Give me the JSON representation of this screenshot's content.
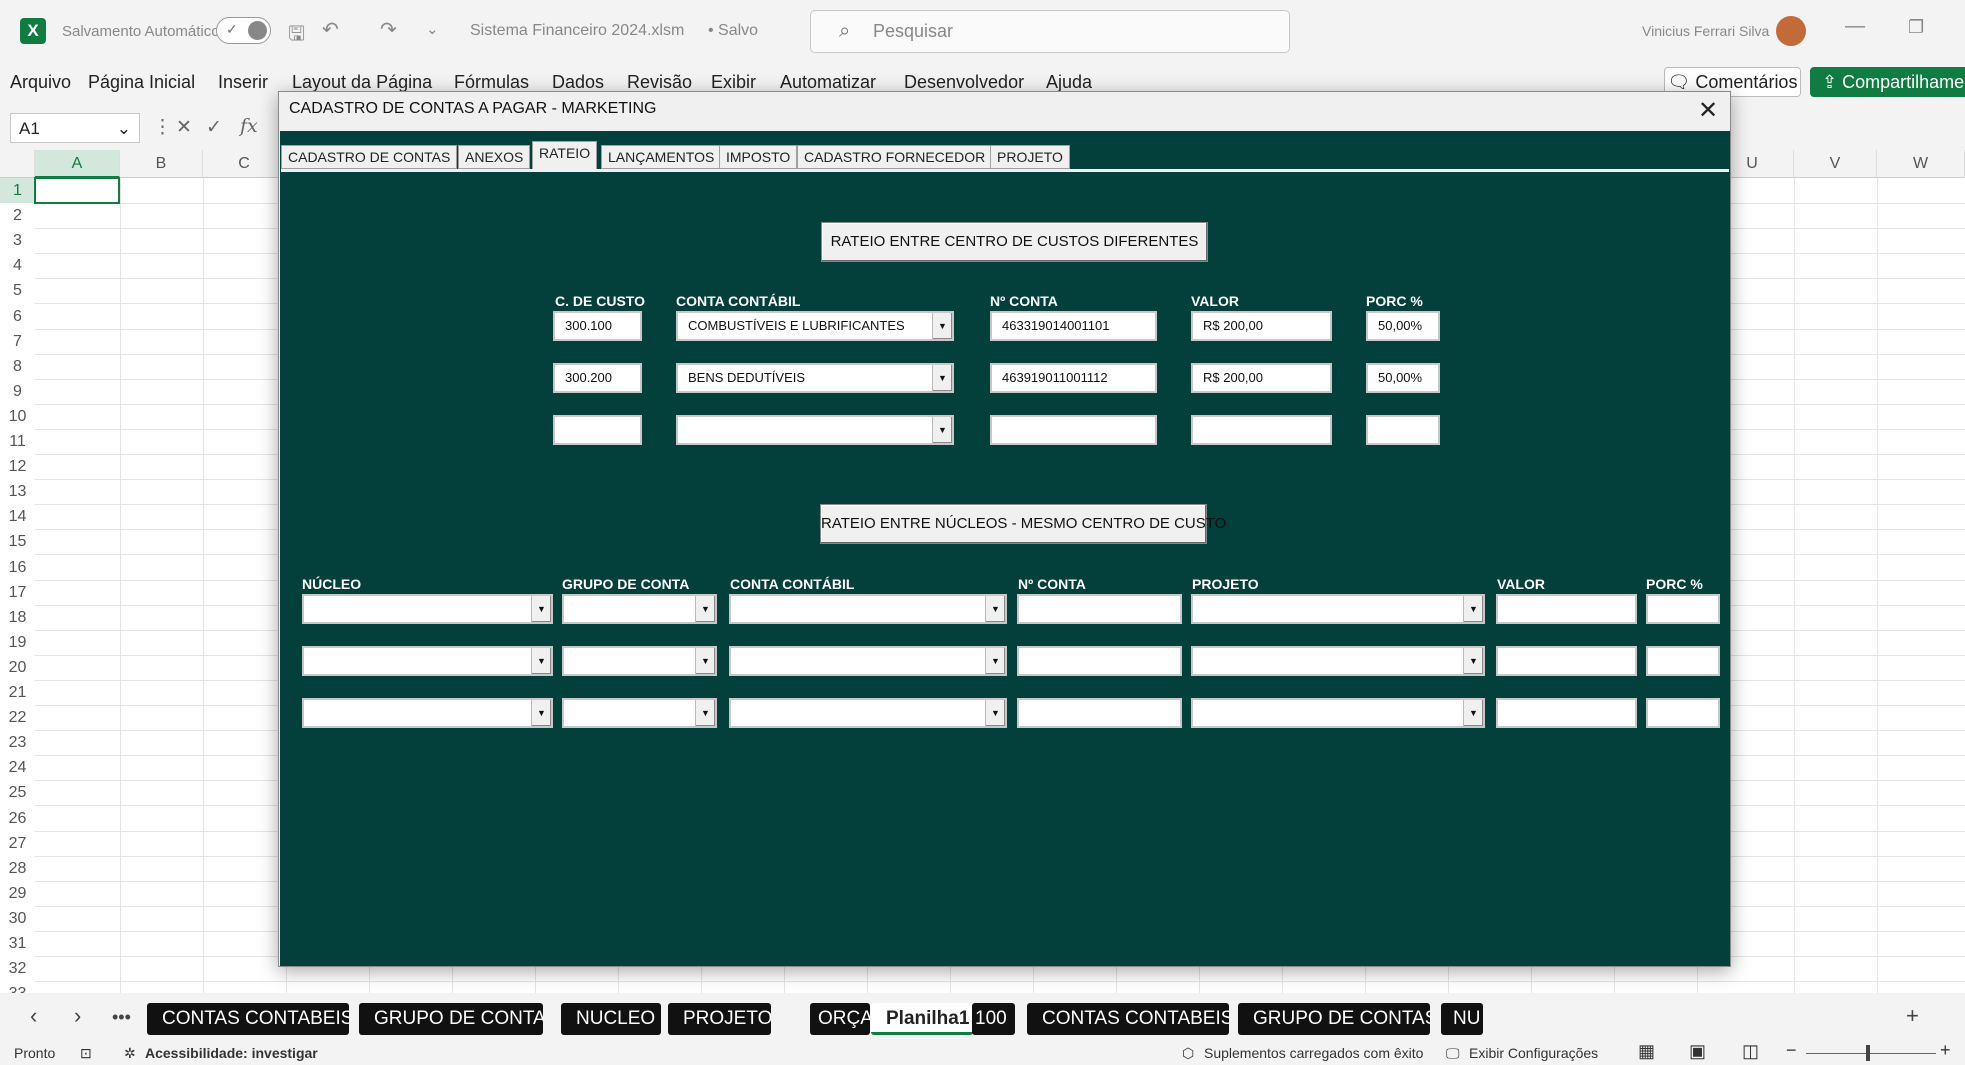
{
  "titlebar": {
    "app_icon": "X",
    "autosave_label": "Salvamento Automático",
    "file_name": "Sistema Financeiro 2024.xlsm",
    "save_status": "• Salvo",
    "search_placeholder": "Pesquisar",
    "user_name": "Vinicius Ferrari Silva"
  },
  "menu": [
    "Arquivo",
    "Página Inicial",
    "Inserir",
    "Layout da Página",
    "Fórmulas",
    "Dados",
    "Revisão",
    "Exibir",
    "Automatizar",
    "Desenvolvedor",
    "Ajuda"
  ],
  "comments_label": "Comentários",
  "share_label": "Compartilhamento",
  "formula_bar": {
    "name_box": "A1",
    "fx": "fx"
  },
  "columns": [
    "A",
    "B",
    "C",
    "U",
    "V",
    "W"
  ],
  "rows": [
    "1",
    "2",
    "3",
    "4",
    "5",
    "6",
    "7",
    "8",
    "9",
    "10",
    "11",
    "12",
    "13",
    "14",
    "15",
    "16",
    "17",
    "18",
    "19",
    "20",
    "21",
    "22",
    "23",
    "24",
    "25",
    "26",
    "27",
    "28",
    "29",
    "30",
    "31",
    "32",
    "33"
  ],
  "dialog": {
    "title": "CADASTRO DE CONTAS A PAGAR - MARKETING",
    "close": "✕",
    "tabs": [
      "CADASTRO DE CONTAS",
      "ANEXOS",
      "RATEIO",
      "LANÇAMENTOS",
      "IMPOSTO",
      "CADASTRO FORNECEDOR",
      "PROJETO"
    ],
    "active_tab": "RATEIO",
    "section1": {
      "button": "RATEIO ENTRE CENTRO DE CUSTOS DIFERENTES",
      "headers": {
        "centro": "C. DE CUSTO",
        "conta": "CONTA CONTÁBIL",
        "numero": "Nº CONTA",
        "valor": "VALOR",
        "porc": "PORC %"
      },
      "rows": [
        {
          "centro": "300.100",
          "conta": "COMBUSTÍVEIS E LUBRIFICANTES",
          "numero": "463319014001101",
          "valor": "R$ 200,00",
          "porc": "50,00%"
        },
        {
          "centro": "300.200",
          "conta": "BENS DEDUTÍVEIS",
          "numero": "463919011001112",
          "valor": "R$ 200,00",
          "porc": "50,00%"
        },
        {
          "centro": "",
          "conta": "",
          "numero": "",
          "valor": "",
          "porc": ""
        }
      ]
    },
    "section2": {
      "button": "RATEIO ENTRE NÚCLEOS - MESMO CENTRO DE CUSTO",
      "headers": {
        "nucleo": "NÚCLEO",
        "grupo": "GRUPO DE CONTA",
        "conta": "CONTA CONTÁBIL",
        "numero": "Nº CONTA",
        "projeto": "PROJETO",
        "valor": "VALOR",
        "porc": "PORC %"
      }
    }
  },
  "sheet_tabs": [
    "CONTAS CONTABEIS",
    "GRUPO DE CONTAS",
    "NUCLEO",
    "PROJETO",
    "ORÇA",
    "Planilha1",
    "100",
    "CONTAS CONTABEIS",
    "GRUPO DE CONTAS",
    "NU"
  ],
  "active_sheet": "Planilha1",
  "status": {
    "ready": "Pronto",
    "accessibility": "Acessibilidade: investigar",
    "addins": "Suplementos carregados com êxito",
    "display_settings": "Exibir Configurações"
  },
  "colors": {
    "excel_green": "#107c41",
    "dialog_bg": "#033f3b",
    "tab_bg": "#111111"
  }
}
